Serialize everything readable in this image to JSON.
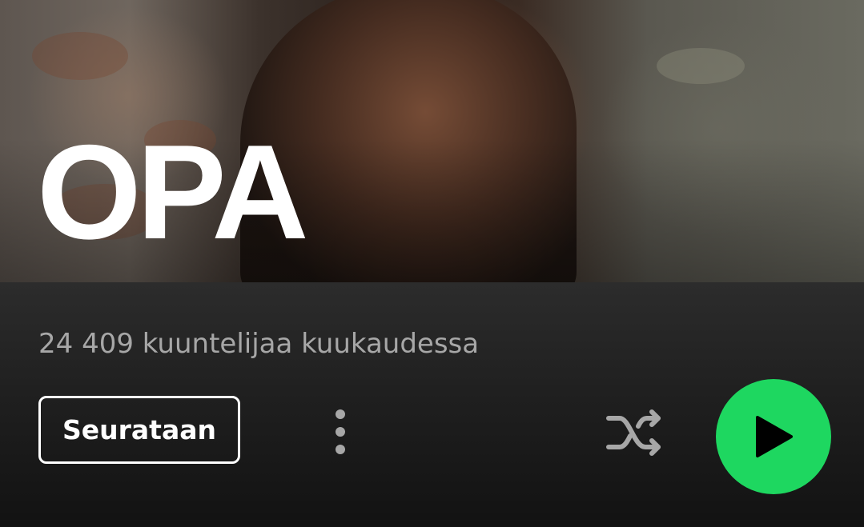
{
  "artist": {
    "name": "OPA",
    "monthly_listeners": "24 409 kuuntelijaa kuukaudessa"
  },
  "actions": {
    "follow_label": "Seurataan",
    "more_icon": "more-vertical-icon",
    "shuffle_icon": "shuffle-icon",
    "play_icon": "play-icon"
  },
  "colors": {
    "accent": "#1ed760",
    "background": "#121212",
    "secondary_text": "#a7a7a7"
  }
}
